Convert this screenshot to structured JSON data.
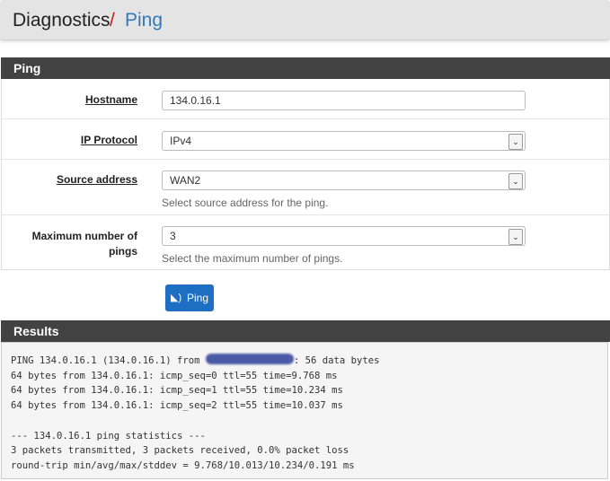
{
  "breadcrumb": {
    "section": "Diagnostics",
    "separator": "/",
    "page": "Ping"
  },
  "ping_panel": {
    "title": "Ping",
    "hostname": {
      "label": "Hostname",
      "value": "134.0.16.1"
    },
    "ip_protocol": {
      "label": "IP Protocol",
      "value": "IPv4"
    },
    "source_address": {
      "label": "Source address",
      "value": "WAN2",
      "help": "Select source address for the ping."
    },
    "max_pings": {
      "label_line1": "Maximum number of",
      "label_line2": "pings",
      "value": "3",
      "help": "Select the maximum number of pings."
    },
    "ping_button": "Ping",
    "ping_icon": "rss-icon"
  },
  "results": {
    "title": "Results",
    "line1_prefix": "PING 134.0.16.1 (134.0.16.1) from ",
    "line1_suffix": ": 56 data bytes",
    "lines": [
      "64 bytes from 134.0.16.1: icmp_seq=0 ttl=55 time=9.768 ms",
      "64 bytes from 134.0.16.1: icmp_seq=1 ttl=55 time=10.234 ms",
      "64 bytes from 134.0.16.1: icmp_seq=2 ttl=55 time=10.037 ms",
      "",
      "--- 134.0.16.1 ping statistics ---",
      "3 packets transmitted, 3 packets received, 0.0% packet loss",
      "round-trip min/avg/max/stddev = 9.768/10.013/10.234/0.191 ms"
    ]
  }
}
